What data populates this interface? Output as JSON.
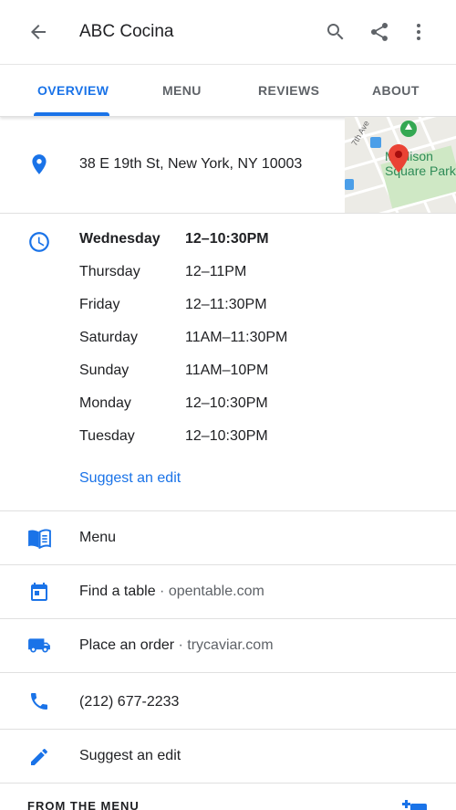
{
  "header": {
    "title": "ABC Cocina",
    "icons": {
      "back": "arrow-back-icon",
      "search": "search-icon",
      "share": "share-icon",
      "more": "more-vert-icon"
    }
  },
  "tabs": [
    {
      "label": "OVERVIEW",
      "active": true
    },
    {
      "label": "MENU",
      "active": false
    },
    {
      "label": "REVIEWS",
      "active": false
    },
    {
      "label": "ABOUT",
      "active": false
    }
  ],
  "address": {
    "text": "38 E 19th St, New York, NY 10003",
    "map": {
      "street_label": "7th Ave",
      "park_label_line1": "Madison",
      "park_label_line2": "Square Park"
    }
  },
  "hours": {
    "rows": [
      {
        "day": "Wednesday",
        "time": "12–10:30PM",
        "today": true
      },
      {
        "day": "Thursday",
        "time": "12–11PM"
      },
      {
        "day": "Friday",
        "time": "12–11:30PM"
      },
      {
        "day": "Saturday",
        "time": "11AM–11:30PM"
      },
      {
        "day": "Sunday",
        "time": "11AM–10PM"
      },
      {
        "day": "Monday",
        "time": "12–10:30PM"
      },
      {
        "day": "Tuesday",
        "time": "12–10:30PM"
      }
    ],
    "suggest_edit": "Suggest an edit"
  },
  "actions": {
    "menu": {
      "label": "Menu"
    },
    "find_table": {
      "label": "Find a table",
      "sub": " · opentable.com"
    },
    "place_order": {
      "label": "Place an order",
      "sub": " · trycaviar.com"
    },
    "phone": {
      "label": "(212) 677-2233"
    },
    "suggest_edit": {
      "label": "Suggest an edit"
    }
  },
  "from_menu": {
    "label": "FROM THE MENU"
  },
  "colors": {
    "accent": "#1a73e8",
    "text": "#202124",
    "secondary": "#5f6368",
    "pin": "#ea4335"
  }
}
